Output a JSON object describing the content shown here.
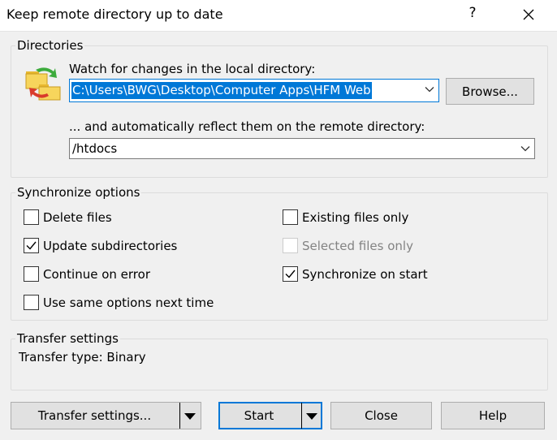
{
  "window": {
    "title": "Keep remote directory up to date",
    "help_glyph": "?"
  },
  "directories": {
    "group_label": "Directories",
    "local_label": "Watch for changes in the local directory:",
    "local_value": "C:\\Users\\BWG\\Desktop\\Computer Apps\\HFM Web",
    "browse_label": "Browse...",
    "remote_label": "... and automatically reflect them on the remote directory:",
    "remote_value": "/htdocs"
  },
  "sync": {
    "group_label": "Synchronize options",
    "options": [
      {
        "label": "Delete files",
        "checked": false,
        "enabled": true
      },
      {
        "label": "Update subdirectories",
        "checked": true,
        "enabled": true
      },
      {
        "label": "Continue on error",
        "checked": false,
        "enabled": true
      },
      {
        "label": "Use same options next time",
        "checked": false,
        "enabled": true
      },
      {
        "label": "Existing files only",
        "checked": false,
        "enabled": true
      },
      {
        "label": "Selected files only",
        "checked": false,
        "enabled": false
      },
      {
        "label": "Synchronize on start",
        "checked": true,
        "enabled": true
      }
    ]
  },
  "transfer": {
    "group_label": "Transfer settings",
    "type_text": "Transfer type: Binary"
  },
  "buttons": {
    "transfer_settings": "Transfer settings...",
    "start": "Start",
    "close": "Close",
    "help": "Help"
  },
  "icons": {
    "folder_sync": "folder-sync-icon",
    "close": "close-icon",
    "dropdown": "chevron-down-icon",
    "check": "checkmark-icon"
  },
  "colors": {
    "accent": "#0078d7",
    "dialog_bg": "#f0f0f0",
    "disabled_text": "#838383"
  }
}
